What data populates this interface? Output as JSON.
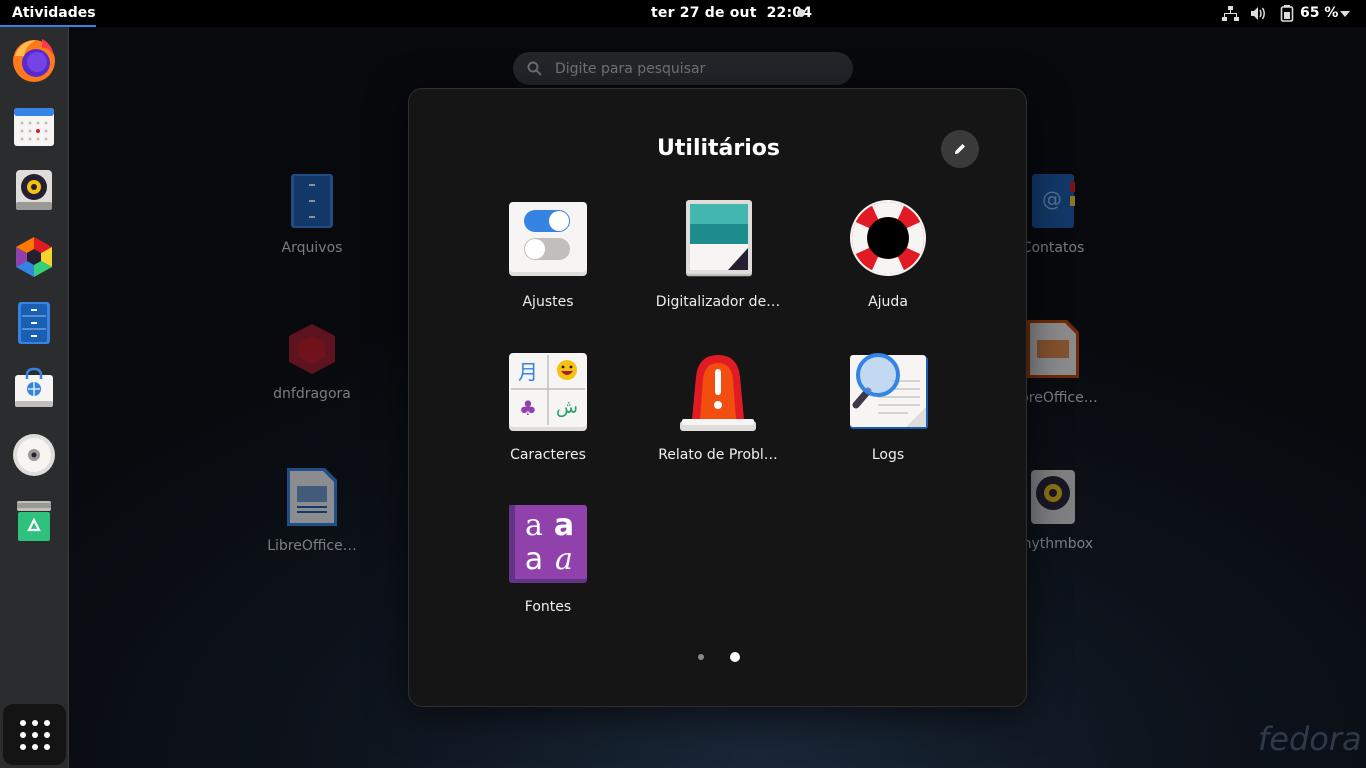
{
  "topbar": {
    "activities": "Atividades",
    "date": "ter 27 de out",
    "time": "22:04",
    "battery_percent": "65 %",
    "tray_icons": [
      "network-icon",
      "volume-icon",
      "battery-icon",
      "system-menu-arrow-icon"
    ]
  },
  "dash": {
    "items": [
      "firefox-icon",
      "calendar-icon",
      "rhythmbox-icon",
      "app-icon",
      "files-icon",
      "software-icon",
      "disc-icon",
      "trash-icon"
    ],
    "show_apps": "show-apps-icon"
  },
  "overview": {
    "search_placeholder": "Digite para pesquisar",
    "apps": {
      "arquivos": "Arquivos",
      "dnfdragora": "dnfdragora",
      "libreoffice_writer": "LibreOffice…",
      "contatos": "Contatos",
      "libreoffice_impress": "LibreOffice…",
      "rhythmbox": "Rhythmbox"
    },
    "fedora_wordmark": "fedora"
  },
  "folder": {
    "title": "Utilitários",
    "apps": [
      {
        "label": "Ajustes",
        "icon": "tweaks-icon"
      },
      {
        "label": "Digitalizador de…",
        "icon": "scanner-icon"
      },
      {
        "label": "Ajuda",
        "icon": "help-lifebuoy-icon"
      },
      {
        "label": "Caracteres",
        "icon": "characters-icon"
      },
      {
        "label": "Relato de Probl…",
        "icon": "problem-reporter-siren-icon"
      },
      {
        "label": "Logs",
        "icon": "logs-magnifier-icon"
      },
      {
        "label": "Fontes",
        "icon": "fonts-icon"
      }
    ],
    "pages": 2,
    "current_page": 2
  },
  "colors": {
    "accent": "#3584e4",
    "panel_bg": "#151515",
    "dash_bg": "#2b2c2e"
  }
}
